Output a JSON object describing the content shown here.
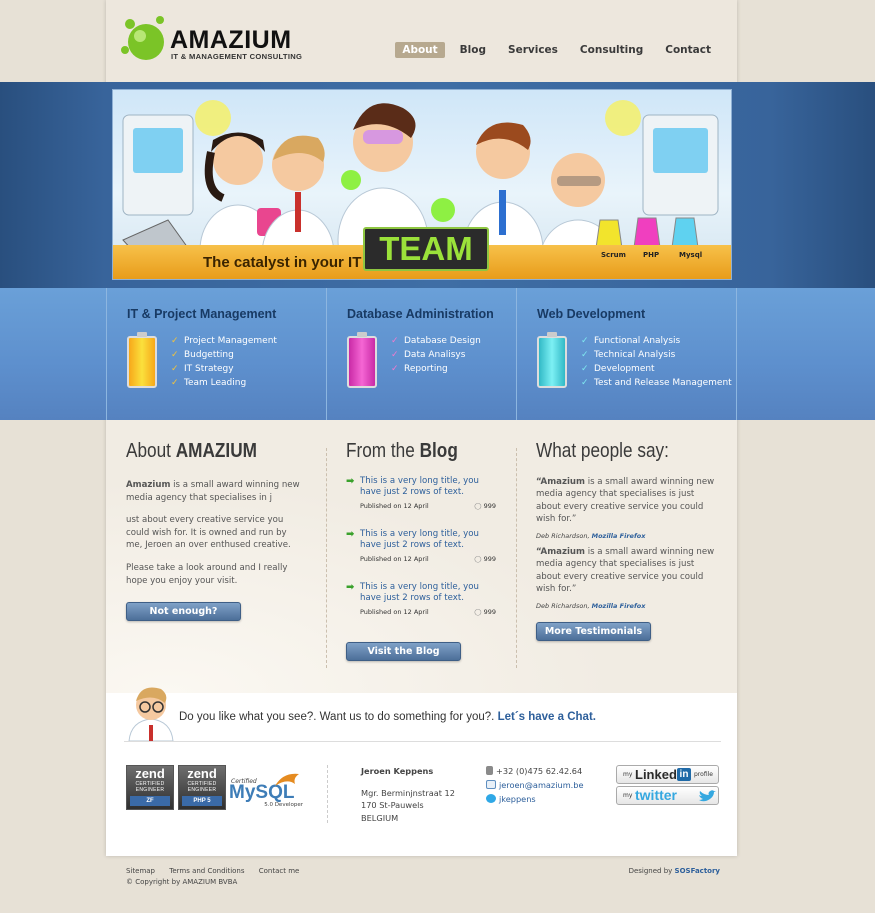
{
  "brand": {
    "name": "AMAZIUM",
    "tagline": "IT & MANAGEMENT CONSULTING"
  },
  "nav": [
    {
      "label": "About",
      "active": true
    },
    {
      "label": "Blog",
      "active": false
    },
    {
      "label": "Services",
      "active": false
    },
    {
      "label": "Consulting",
      "active": false
    },
    {
      "label": "Contact",
      "active": false
    }
  ],
  "hero": {
    "tagline": "The catalyst in your IT",
    "team": "TEAM",
    "flask_labels": [
      "Scrum",
      "PHP",
      "Mysql"
    ]
  },
  "services": [
    {
      "title": "IT & Project Management",
      "color": "#f4b71f",
      "items": [
        "Project Management",
        "Budgetting",
        "IT Strategy",
        "Team Leading"
      ]
    },
    {
      "title": "Database Administration",
      "color": "#e93fbf",
      "items": [
        "Database Design",
        "Data Analisys",
        "Reporting"
      ]
    },
    {
      "title": "Web Development",
      "color": "#4fd6e0",
      "items": [
        "Functional Analysis",
        "Technical Analysis",
        "Development",
        "Test and Release Management"
      ]
    }
  ],
  "about": {
    "heading_light": "About",
    "heading_bold": "AMAZIUM",
    "lead_bold": "Amazium",
    "p1": " is a small award winning new media agency that specialises in j",
    "p2": "ust about every creative service you could wish for. It is owned and run by me, Jeroen an over enthused creative.",
    "p3": "Please take a look around and I really hope you enjoy your visit.",
    "button": "Not enough?"
  },
  "blog": {
    "heading_light": "From the",
    "heading_bold": "Blog",
    "posts": [
      {
        "title": "This is a very long title, you have just 2 rows of text.",
        "meta": "Published on 12 April",
        "comments": "999"
      },
      {
        "title": "This is a very long title, you have just 2 rows of text.",
        "meta": "Published on 12 April",
        "comments": "999"
      },
      {
        "title": "This is a very long title, you have just 2 rows of text.",
        "meta": "Published on 12 April",
        "comments": "999"
      }
    ],
    "button": "Visit the Blog"
  },
  "testimonials": {
    "heading": "What people say:",
    "items": [
      {
        "lead": "“Amazium",
        "text": " is a small award winning new media agency that specialises is just about every creative service you could wish for.”",
        "author": "Deb Richardson, ",
        "company": "Mozilla Firefox"
      },
      {
        "lead": "“Amazium",
        "text": " is a small award winning new media agency that specialises is just about every creative service you could wish for.”",
        "author": "Deb Richardson, ",
        "company": "Mozilla Firefox"
      }
    ],
    "button": "More Testimonials"
  },
  "chat": {
    "text": "Do you like what you see?. Want us to do something for you?.",
    "link": "Let´s have a Chat."
  },
  "certs": [
    {
      "brand": "zend",
      "line1": "CERTIFIED",
      "line2": "ENGINEER",
      "strip": "ZF"
    },
    {
      "brand": "zend",
      "line1": "CERTIFIED",
      "line2": "ENGINEER",
      "strip": "PHP 5"
    }
  ],
  "mysql": {
    "top": "Certified",
    "name": "MySQL",
    "bottom": "5.0 Developer"
  },
  "contact": {
    "name": "Jeroen Keppens",
    "address": [
      "Mgr. Berminjnstraat 12",
      "170 St-Pauwels",
      "BELGIUM"
    ],
    "phone": "+32 (0)475 62.42.64",
    "email": "jeroen@amazium.be",
    "skype": "jkeppens"
  },
  "social": [
    {
      "small": "my",
      "big": "Linked",
      "badge": "in",
      "suffix": "profile"
    },
    {
      "small": "my",
      "big": "twitter"
    }
  ],
  "footer": {
    "links": [
      "Sitemap",
      "Terms and Conditions",
      "Contact me"
    ],
    "copyright": "© Copyright by AMAZIUM BVBA",
    "designed_by": "Designed by ",
    "designer": "SOSFactory"
  }
}
